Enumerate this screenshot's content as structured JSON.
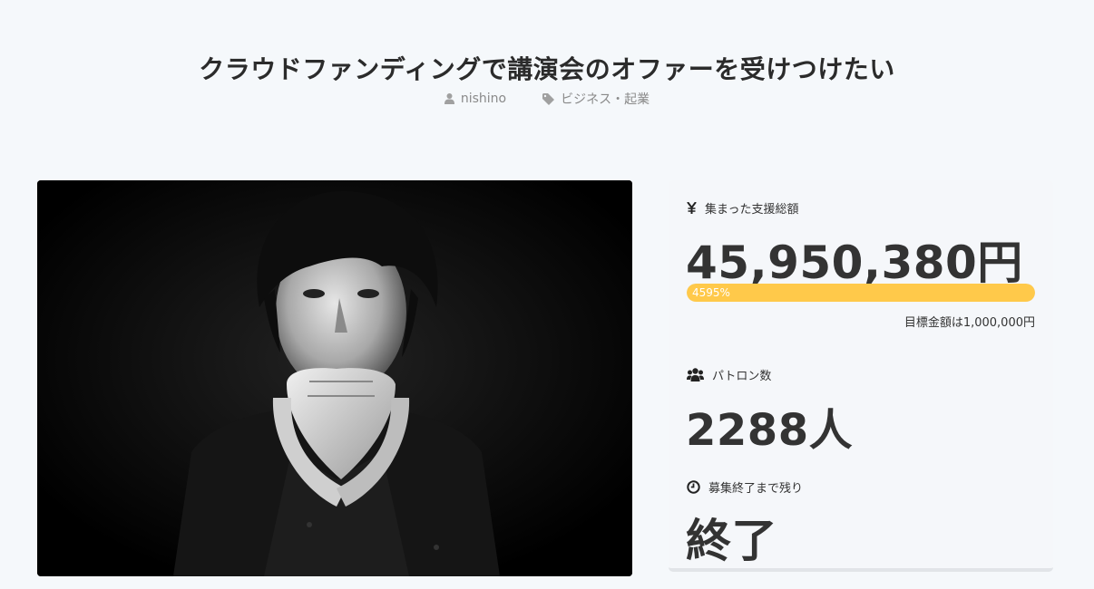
{
  "page": {
    "title": "クラウドファンディングで講演会のオファーを受けつけたい"
  },
  "meta": {
    "author": "nishino",
    "category": "ビジネス・起業"
  },
  "hero": {
    "icon": "portrait-photo"
  },
  "stats": {
    "total": {
      "icon": "yen-icon",
      "label": "集まった支援総額",
      "value": "45,950,380円"
    },
    "progress": {
      "percent_text": "4595%",
      "fraction": 1.0,
      "color": "#ffc94a"
    },
    "goal": "目標金額は1,000,000円",
    "patrons": {
      "icon": "users-icon",
      "label": "パトロン数",
      "value": "2288人"
    },
    "remaining": {
      "icon": "clock-icon",
      "label": "募集終了まで残り",
      "value": "終了"
    }
  }
}
